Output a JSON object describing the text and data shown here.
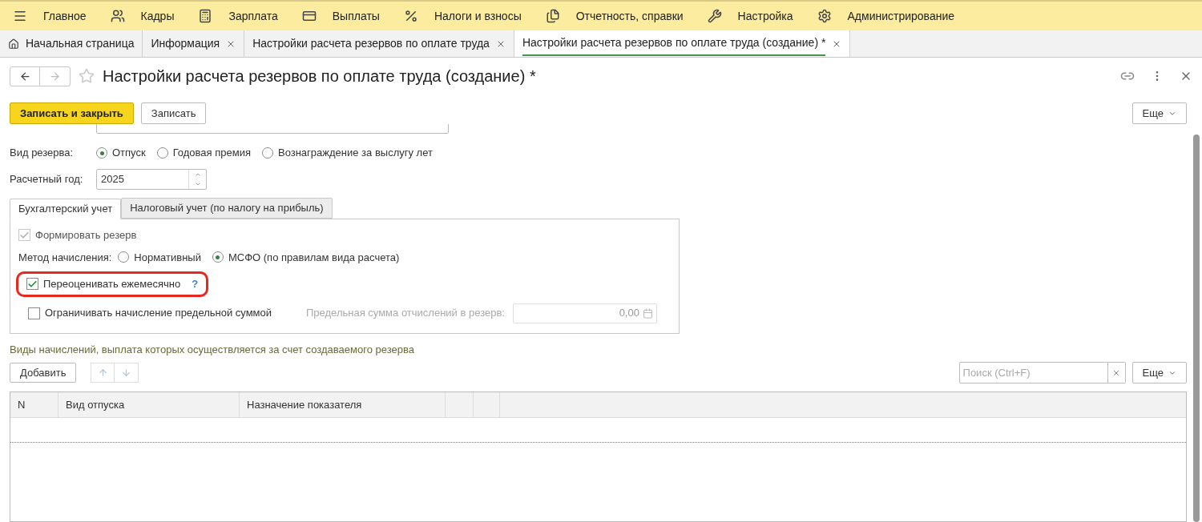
{
  "menu": [
    {
      "label": "Главное"
    },
    {
      "label": "Кадры"
    },
    {
      "label": "Зарплата"
    },
    {
      "label": "Выплаты"
    },
    {
      "label": "Налоги и взносы"
    },
    {
      "label": "Отчетность, справки"
    },
    {
      "label": "Настройка"
    },
    {
      "label": "Администрирование"
    }
  ],
  "tabs": [
    {
      "label": "Начальная страница",
      "selected": false,
      "closable": false
    },
    {
      "label": "Информация",
      "selected": false,
      "closable": true
    },
    {
      "label": "Настройки расчета резервов по оплате труда",
      "selected": false,
      "closable": true
    },
    {
      "label": "Настройки расчета резервов по оплате труда (создание) *",
      "selected": true,
      "closable": true
    }
  ],
  "form": {
    "title": "Настройки расчета резервов по оплате труда (создание) *",
    "buttons": [
      {
        "label": "Записать и закрыть",
        "kind": "primary"
      },
      {
        "label": "Записать",
        "kind": "normal"
      }
    ],
    "more_button": "Еще",
    "reserve_type": {
      "label": "Вид резерва:",
      "options": [
        {
          "label": "Отпуск",
          "selected": true
        },
        {
          "label": "Годовая премия",
          "selected": false
        },
        {
          "label": "Вознаграждение за выслугу лет",
          "selected": false
        }
      ]
    },
    "year": {
      "label": "Расчетный год:",
      "value": "2025"
    },
    "subtabs": [
      {
        "label": "Бухгалтерский учет",
        "selected": true
      },
      {
        "label": "Налоговый учет (по налогу на прибыль)",
        "selected": false
      }
    ],
    "form_reserve": {
      "label": "Формировать резерв",
      "checked": true,
      "disabled": true
    },
    "method": {
      "label": "Метод начисления:",
      "options": [
        {
          "label": "Нормативный",
          "selected": false
        },
        {
          "label": "МСФО (по правилам вида расчета)",
          "selected": true
        }
      ]
    },
    "revalue": {
      "label": "Переоценивать ежемесячно",
      "checked": true,
      "help": "?"
    },
    "limit": {
      "label": "Ограничивать начисление предельной суммой",
      "checked": false
    },
    "limit_sum": {
      "label": "Предельная сумма отчислений в резерв:",
      "value": "0,00"
    },
    "section_title": "Виды начислений, выплата которых осуществляется за счет создаваемого резерва",
    "add_button": "Добавить",
    "search": {
      "placeholder": "Поиск (Ctrl+F)"
    },
    "table_more_button": "Еще",
    "table": {
      "columns": [
        "N",
        "Вид отпуска",
        "Назначение показателя"
      ]
    }
  }
}
